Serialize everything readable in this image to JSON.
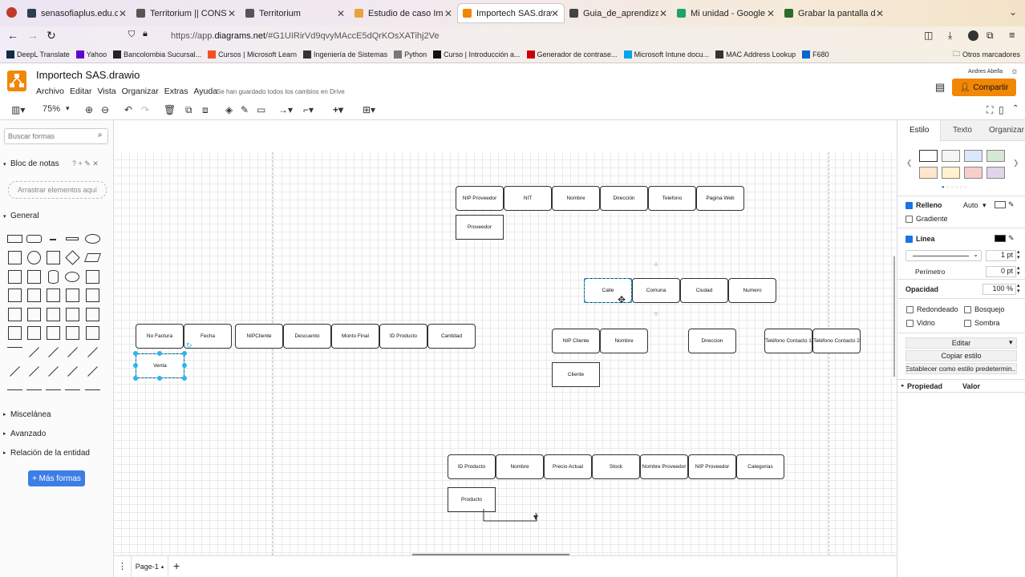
{
  "browser": {
    "tabs": [
      {
        "label": "senasofiaplus.edu.co/sofia",
        "color": "#2c3e50"
      },
      {
        "label": "Territorium || CONSTRUCCI",
        "color": "#555"
      },
      {
        "label": "Territorium",
        "color": "#555"
      },
      {
        "label": "Estudio de caso Import Tec",
        "color": "#e8a33d"
      },
      {
        "label": "Importech SAS.drawio - dra",
        "color": "#f08705"
      },
      {
        "label": "Guia_de_aprendizaje.pdf",
        "color": "#444"
      },
      {
        "label": "Mi unidad - Google Drive",
        "color": "#1fa463"
      },
      {
        "label": "Grabar la pantalla de Wind",
        "color": "#2a6b2a"
      }
    ],
    "url_prefix": "https://app.",
    "url_domain": "diagrams.net",
    "url_rest": "/#G1UIRirVd9qvyMAccE5dQrKOsXATihj2Ve",
    "bookmarks": [
      {
        "label": "DeepL Translate",
        "color": "#0f2b46"
      },
      {
        "label": "Yahoo",
        "color": "#6001d2"
      },
      {
        "label": "Bancolombia Sucursal...",
        "color": "#222"
      },
      {
        "label": "Cursos | Microsoft Learn",
        "color": "#f25022"
      },
      {
        "label": "Ingeniería de Sistemas",
        "color": "#333"
      },
      {
        "label": "Python",
        "color": "#777"
      },
      {
        "label": "Curso | Introducción a...",
        "color": "#111"
      },
      {
        "label": "Generador de contrase...",
        "color": "#c00"
      },
      {
        "label": "Microsoft Intune docu...",
        "color": "#00a4ef"
      },
      {
        "label": "MAC Address Lookup",
        "color": "#333"
      },
      {
        "label": "F680",
        "color": "#0066cc"
      }
    ],
    "other_bookmarks": "Otros marcadores"
  },
  "app": {
    "title": "Importech SAS.drawio",
    "menu": [
      "Archivo",
      "Editar",
      "Vista",
      "Organizar",
      "Extras",
      "Ayuda"
    ],
    "save_status": "Se han guardado todos los cambios en Drive",
    "user": "Andres Abella",
    "share": "Compartir",
    "accent": "#f08705",
    "zoom": "75%"
  },
  "left": {
    "search_placeholder": "Buscar formas",
    "notes_title": "Bloc de notas",
    "notes_drop": "Arrastrar elementos aquí",
    "general": "General",
    "sections": [
      "Miscelánea",
      "Avanzado",
      "Relación de la entidad"
    ],
    "more_shapes": "+ Más formas"
  },
  "diagram": {
    "proveedor_attrs": [
      "NIP Proveedor",
      "NIT",
      "Nombre",
      "Dirección",
      "Telefono",
      "Pagina Web"
    ],
    "proveedor": "Proveedor",
    "direccion_attrs": [
      "Calle",
      "Comuna",
      "Ciudad",
      "Numero"
    ],
    "venta_attrs": [
      "No Factura",
      "Fecha",
      "NIPCliente",
      "Descuento",
      "Monto Final",
      "ID Producto",
      "Cantidad"
    ],
    "venta": "Venta",
    "cliente_attrs": [
      "NIP Cliente",
      "Nombre",
      "Direccion",
      "Teléfono Contacto 1",
      "Teléfono Contacto 2"
    ],
    "cliente": "Cliente",
    "producto_attrs": [
      "ID Producto",
      "Nombre",
      "Precio Actual",
      "Stock",
      "Nombre Proveedor",
      "NIP Proveedor",
      "Categorias"
    ],
    "producto": "Producto"
  },
  "right": {
    "tabs": [
      "Estilo",
      "Texto",
      "Organizar"
    ],
    "fill": "Relleno",
    "fill_mode": "Auto",
    "gradient": "Gradiente",
    "line": "Línea",
    "line_width": "1 pt",
    "perimeter": "Perímetro",
    "perimeter_value": "0 pt",
    "opacity": "Opacidad",
    "opacity_value": "100 %",
    "rounded": "Redondeado",
    "sketch": "Bosquejo",
    "glass": "Vidrio",
    "shadow": "Sombra",
    "edit": "Editar",
    "copy_style": "Copiar estilo",
    "set_default": "Establecer como estilo predetermin...",
    "prop": "Propiedad",
    "value": "Valor",
    "swatches": [
      "#ffffff",
      "#f5f5f5",
      "#dae8fc",
      "#d5e8d4",
      "#ffe6cc",
      "#fff2cc",
      "#f8cecc",
      "#e1d5e7"
    ]
  },
  "footer": {
    "page": "Page-1"
  }
}
